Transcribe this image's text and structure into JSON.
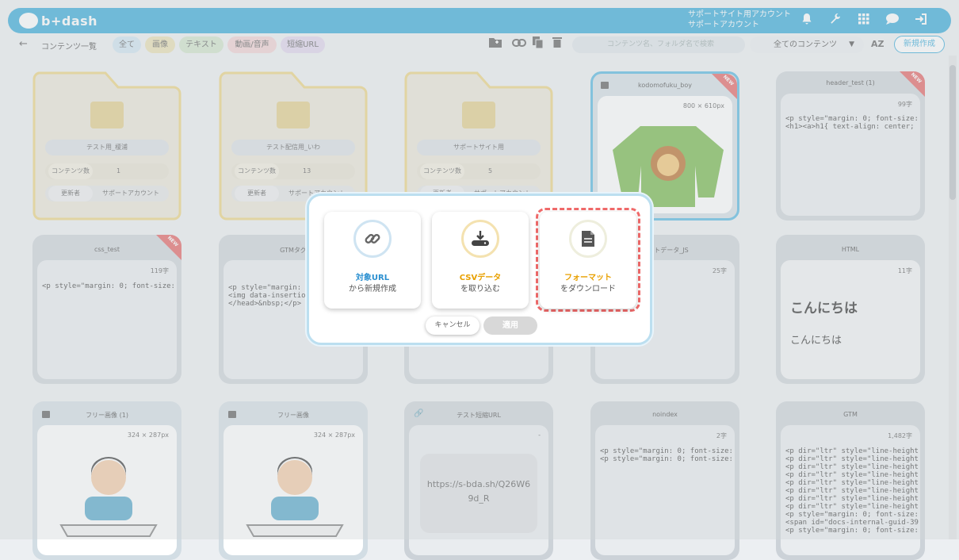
{
  "app": {
    "logo_text": "b+dash",
    "account_line1": "サポートサイト用アカウント",
    "account_line2": "サポートアカウント",
    "accent": "#2aa5d8"
  },
  "topbar_icons": [
    "bell-icon",
    "wrench-icon",
    "grid-icon",
    "chat-icon",
    "logout-icon"
  ],
  "toolbar": {
    "back_label": "←",
    "breadcrumb": "コンテンツ一覧",
    "filters": [
      {
        "label": "全て",
        "color": "#cde4f2"
      },
      {
        "label": "画像",
        "color": "#e9dfae"
      },
      {
        "label": "テキスト",
        "color": "#cfe3c9"
      },
      {
        "label": "動画/音声",
        "color": "#f2cfd0"
      },
      {
        "label": "短縮URL",
        "color": "#ded2ec"
      }
    ],
    "search_placeholder": "コンテンツ名、フォルダ名で検索",
    "select_value": "全てのコンテンツ",
    "sort_label": "AZ",
    "new_button": "新規作成"
  },
  "folders": [
    {
      "name": "テスト用_榎浦",
      "count_label": "コンテンツ数",
      "count": "1",
      "updater_label": "更新者",
      "updater": "サポートアカウント"
    },
    {
      "name": "テスト配信用_いわ",
      "count_label": "コンテンツ数",
      "count": "13",
      "updater_label": "更新者",
      "updater": "サポートアカウント"
    },
    {
      "name": "サポートサイト用",
      "count_label": "コンテンツ数",
      "count": "5",
      "updater_label": "更新者",
      "updater": "サポートアカウント"
    }
  ],
  "cards": {
    "kodomo": {
      "title": "kodomofuku_boy",
      "size": "800 × 610px",
      "new": "NEW"
    },
    "header_test": {
      "title": "header_test (1)",
      "size": "99字",
      "code": "<p style=\"margin: 0; font-size: 18\n<h1><a>h1{ text-align: center; fo",
      "new": "NEW"
    },
    "css_test": {
      "title": "css_test",
      "size": "119字",
      "code": "<p style=\"margin: 0; font-size: 18",
      "new": "NEW"
    },
    "gtm_tag": {
      "title": "GTMタグ",
      "code": "<p style=\"margin: 0\n<img data-insertion\n</head>&nbsp;</p>"
    },
    "test_js": {
      "title": "テストデータ_JS",
      "size": "25字"
    },
    "html": {
      "title": "HTML",
      "size": "11字",
      "big": "こんにちは",
      "small": "こんにちは"
    },
    "free1": {
      "title": "フリー画像 (1)",
      "size": "324 × 287px"
    },
    "free2": {
      "title": "フリー画像",
      "size": "324 × 287px"
    },
    "short": {
      "title": "テスト短縮URL",
      "size": "-",
      "url": "https://s-bda.sh/Q26W69d_R"
    },
    "noindex": {
      "title": "noindex",
      "size": "2字",
      "code": "<p style=\"margin: 0; font-size: 18\n<p style=\"margin: 0; font-size: 18"
    },
    "gtm": {
      "title": "GTM",
      "size": "1,482字",
      "code": "<p dir=\"ltr\" style=\"line-height: 1\n<p dir=\"ltr\" style=\"line-height: 1\n<p dir=\"ltr\" style=\"line-height: 1\n<p dir=\"ltr\" style=\"line-height: 1\n<p dir=\"ltr\" style=\"line-height: 1\n<p dir=\"ltr\" style=\"line-height: 1\n<p dir=\"ltr\" style=\"line-height: 1\n<p dir=\"ltr\" style=\"line-height: 1\n<p style=\"margin: 0; font-size: 18\n<span id=\"docs-internal-guid-390\n<p style=\"margin: 0; font-size: 18"
    }
  },
  "modal": {
    "options": [
      {
        "line1": "対象URL",
        "line2": "から新規作成",
        "color": "#2aa5d8",
        "icon": "link-icon"
      },
      {
        "line1": "CSVデータ",
        "line2": "を取り込む",
        "color": "#e8a000",
        "icon": "download-icon"
      },
      {
        "line1": "フォーマット",
        "line2": "をダウンロード",
        "color": "#e8a000",
        "icon": "document-icon"
      }
    ],
    "cancel": "キャンセル",
    "apply": "適用",
    "highlight_color": "#f06a6a"
  }
}
